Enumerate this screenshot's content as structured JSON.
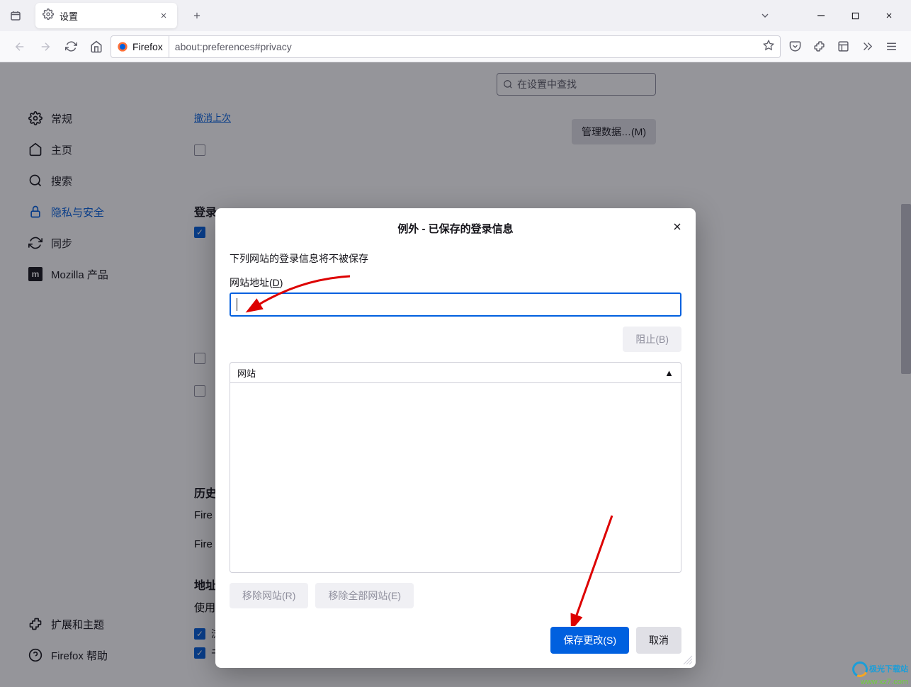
{
  "tab": {
    "title": "设置"
  },
  "url": {
    "firefox_label": "Firefox",
    "path": "about:preferences#privacy"
  },
  "search": {
    "placeholder": "在设置中查找"
  },
  "sidebar": {
    "items": [
      {
        "label": "常规"
      },
      {
        "label": "主页"
      },
      {
        "label": "搜索"
      },
      {
        "label": "隐私与安全"
      },
      {
        "label": "同步"
      },
      {
        "label": "Mozilla 产品"
      }
    ],
    "bottom": [
      {
        "label": "扩展和主题"
      },
      {
        "label": "Firefox 帮助"
      }
    ]
  },
  "page": {
    "link_undo": "撤消上次",
    "manage_data": "管理数据…(M)",
    "logins_h": "登录",
    "history_h": "历史",
    "fire_prefix": "Fire",
    "addressbar_h": "地址栏",
    "addressbar_desc": "使用地址栏时，为我建议：",
    "chk_browse": "浏览历史(H)",
    "chk_bookmarks": "书签(K)"
  },
  "modal": {
    "title": "例外 - 已保存的登录信息",
    "desc": "下列网站的登录信息将不被保存",
    "address_label_pre": "网站地址(",
    "address_label_u": "D",
    "address_label_post": ")",
    "block_btn": "阻止(B)",
    "table_col": "网站",
    "remove_site": "移除网站(R)",
    "remove_all": "移除全部网站(E)",
    "save": "保存更改(S)",
    "cancel": "取消"
  },
  "watermark": {
    "line1": "极光下载站",
    "line2": "www.xz7.com"
  }
}
